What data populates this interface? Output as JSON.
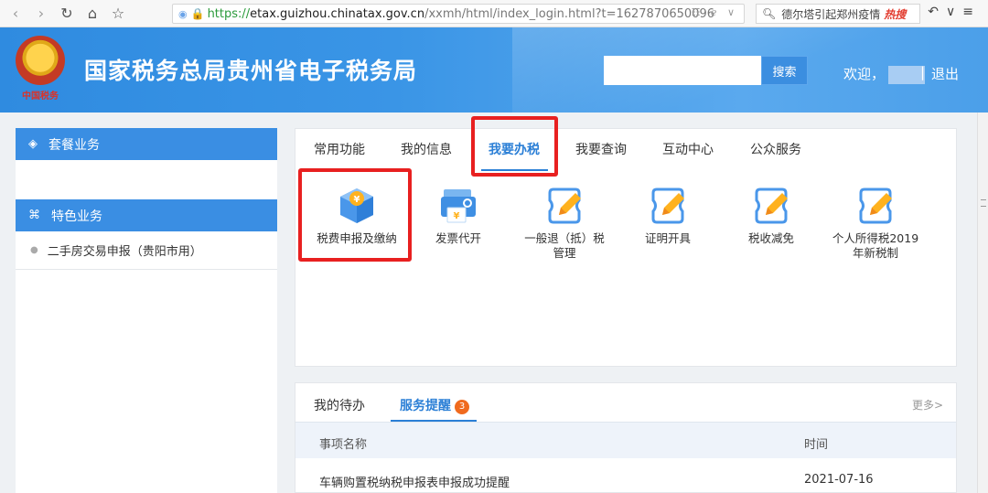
{
  "browser": {
    "url_scheme": "https://",
    "url_host": "etax.guizhou.chinatax.gov.cn",
    "url_rest": "/xxmh/html/index_login.html?t=1627870650096",
    "search_text": "德尔塔引起郑州疫情",
    "hot_label": "热搜"
  },
  "header": {
    "emblem_text": "中国税务",
    "site_title": "国家税务总局贵州省电子税务局",
    "search_button": "搜索",
    "welcome": "欢迎，",
    "separator": "|",
    "logout": "退出"
  },
  "sidebar": {
    "package_title": "套餐业务",
    "special_title": "特色业务",
    "items": [
      {
        "label": "二手房交易申报（贵阳市用）"
      }
    ]
  },
  "tabs": [
    {
      "label": "常用功能"
    },
    {
      "label": "我的信息"
    },
    {
      "label": "我要办税"
    },
    {
      "label": "我要查询"
    },
    {
      "label": "互动中心"
    },
    {
      "label": "公众服务"
    }
  ],
  "functions": [
    {
      "line1": "税费申报及缴纳",
      "line2": "",
      "icon": "tax-declare-icon"
    },
    {
      "line1": "发票代开",
      "line2": "",
      "icon": "invoice-icon"
    },
    {
      "line1": "一般退（抵）税",
      "line2": "管理",
      "icon": "edit-icon"
    },
    {
      "line1": "证明开具",
      "line2": "",
      "icon": "edit-icon"
    },
    {
      "line1": "税收减免",
      "line2": "",
      "icon": "edit-icon"
    },
    {
      "line1": "个人所得税2019",
      "line2": "年新税制",
      "icon": "edit-icon"
    }
  ],
  "bottom": {
    "tab_todo": "我的待办",
    "tab_reminder": "服务提醒",
    "badge": "3",
    "more": "更多>",
    "col_name": "事项名称",
    "col_time": "时间",
    "rows": [
      {
        "name": "车辆购置税纳税申报表申报成功提醒",
        "time": "2021-07-16"
      }
    ]
  },
  "colors": {
    "primary": "#2b7fd6",
    "highlight": "#e82020",
    "badge": "#f06a1e"
  }
}
